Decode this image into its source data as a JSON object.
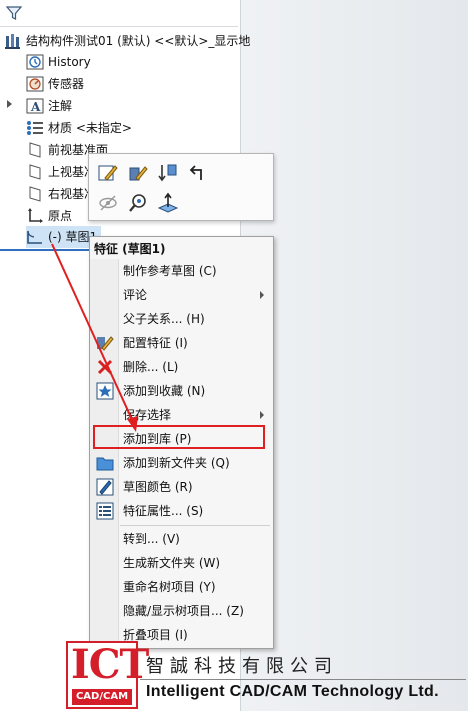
{
  "tree": {
    "root_label": "结构构件测试01 (默认) <<默认>_显示地",
    "items": [
      {
        "label": "History",
        "icon": "history-icon"
      },
      {
        "label": "传感器",
        "icon": "sensor-icon"
      },
      {
        "label": "注解",
        "icon": "annotation-icon"
      },
      {
        "label": "材质 <未指定>",
        "icon": "material-icon"
      },
      {
        "label": "前视基准面",
        "icon": "plane-icon"
      },
      {
        "label": "上视基准面",
        "icon": "plane-icon"
      },
      {
        "label": "右视基准面",
        "icon": "plane-icon"
      },
      {
        "label": "原点",
        "icon": "origin-icon"
      },
      {
        "label": "(-) 草图1",
        "icon": "sketch-icon"
      }
    ]
  },
  "context_menu": {
    "title": "特征 (草图1)",
    "items": [
      {
        "label": "制作参考草图 (C)"
      },
      {
        "label": "评论"
      },
      {
        "label": "父子关系... (H)"
      },
      {
        "label": "配置特征 (I)"
      },
      {
        "label": "删除... (L)"
      },
      {
        "label": "添加到收藏 (N)"
      },
      {
        "label": "保存选择"
      },
      {
        "label": "添加到库 (P)"
      },
      {
        "label": "添加到新文件夹 (Q)"
      },
      {
        "label": "草图颜色 (R)"
      },
      {
        "label": "特征属性... (S)"
      },
      {
        "label": "转到... (V)"
      },
      {
        "label": "生成新文件夹 (W)"
      },
      {
        "label": "重命名树项目 (Y)"
      },
      {
        "label": "隐藏/显示树项目... (Z)"
      },
      {
        "label": "折叠项目 (I)"
      }
    ]
  },
  "colors": {
    "highlight": "#e02020",
    "selection": "#2f6fbf",
    "brand_red": "#d41f2a"
  },
  "footer": {
    "logo_text": "ICT",
    "logo_caption": "CAD/CAM",
    "company_cn": "智誠科技有限公司",
    "company_en": "Intelligent CAD/CAM Technology Ltd."
  }
}
